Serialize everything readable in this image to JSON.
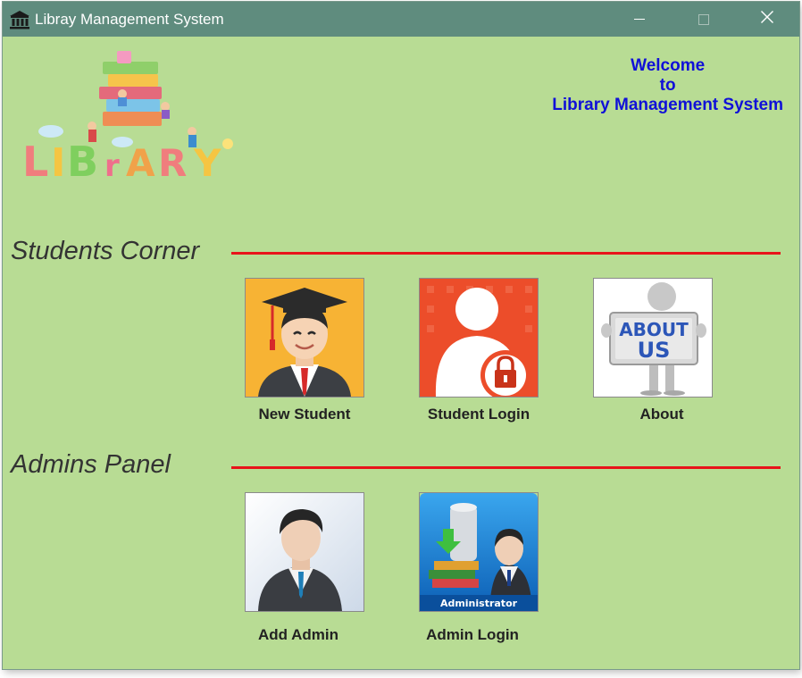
{
  "window": {
    "title": "Libray Management System",
    "controls": {
      "minimize": "minimize-icon",
      "maximize": "maximize-icon",
      "close": "close-icon"
    }
  },
  "header": {
    "logo_text": "LIBRARY",
    "welcome_line1": "Welcome",
    "welcome_line2": "to",
    "welcome_line3": "Library Management System"
  },
  "students": {
    "title": "Students Corner",
    "items": [
      {
        "label": "New Student",
        "icon": "graduate-icon"
      },
      {
        "label": "Student Login",
        "icon": "user-lock-icon"
      },
      {
        "label": "About",
        "icon": "about-us-sign-icon",
        "sign_line1": "ABOUT",
        "sign_line2": "US"
      }
    ]
  },
  "admins": {
    "title": "Admins Panel",
    "items": [
      {
        "label": "Add Admin",
        "icon": "businessman-icon"
      },
      {
        "label": "Admin Login",
        "icon": "administrator-icon",
        "badge": "Administrator"
      }
    ]
  },
  "colors": {
    "background": "#b8dc94",
    "titlebar": "#5f8c7e",
    "welcome_text": "#1010d8",
    "section_rule": "#e8141a"
  }
}
